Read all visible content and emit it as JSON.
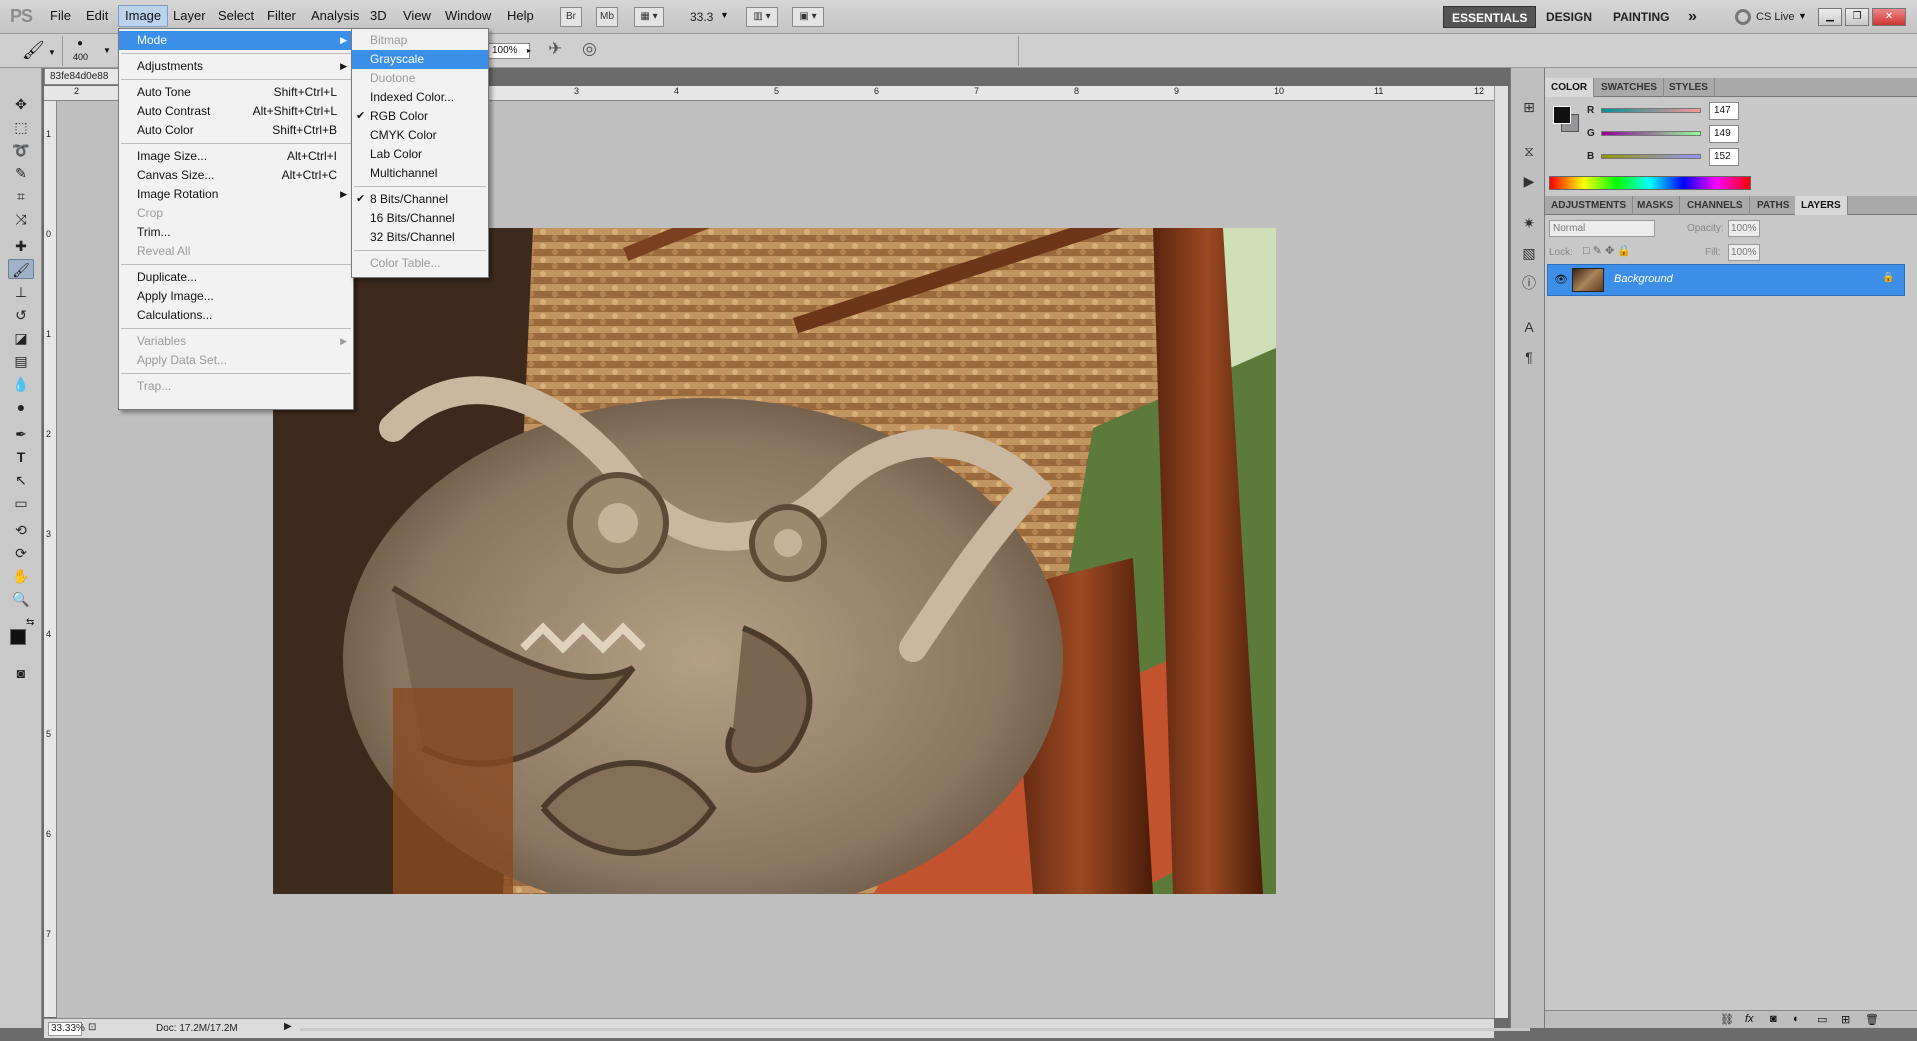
{
  "menubar": {
    "logo": "PS",
    "items": [
      "File",
      "Edit",
      "Image",
      "Layer",
      "Select",
      "Filter",
      "Analysis",
      "3D",
      "View",
      "Window",
      "Help"
    ],
    "bridge": "Br",
    "minibridge": "Mb",
    "zoom": "33.3",
    "workspaces": [
      "ESSENTIALS",
      "DESIGN",
      "PAINTING"
    ],
    "more": "»",
    "cslive": "CS Live"
  },
  "options": {
    "brush_size": "400",
    "flow": "100%"
  },
  "document": {
    "tab_title": "83fe84d0e88",
    "ruler_top": [
      "2",
      "3",
      "4",
      "5",
      "6",
      "7",
      "8",
      "9",
      "10",
      "11",
      "12"
    ],
    "ruler_left": [
      "1",
      "0",
      "1",
      "2",
      "3",
      "4",
      "5",
      "6",
      "7"
    ],
    "zoom_status": "33.33%",
    "doc_info": "Doc: 17.2M/17.2M"
  },
  "image_menu": [
    {
      "label": "Mode",
      "hl": true,
      "sub": true
    },
    {
      "sep": true
    },
    {
      "label": "Adjustments",
      "sub": true
    },
    {
      "sep": true
    },
    {
      "label": "Auto Tone",
      "sc": "Shift+Ctrl+L"
    },
    {
      "label": "Auto Contrast",
      "sc": "Alt+Shift+Ctrl+L"
    },
    {
      "label": "Auto Color",
      "sc": "Shift+Ctrl+B"
    },
    {
      "sep": true
    },
    {
      "label": "Image Size...",
      "sc": "Alt+Ctrl+I"
    },
    {
      "label": "Canvas Size...",
      "sc": "Alt+Ctrl+C"
    },
    {
      "label": "Image Rotation",
      "sub": true
    },
    {
      "label": "Crop",
      "dis": true
    },
    {
      "label": "Trim..."
    },
    {
      "label": "Reveal All",
      "dis": true
    },
    {
      "sep": true
    },
    {
      "label": "Duplicate..."
    },
    {
      "label": "Apply Image..."
    },
    {
      "label": "Calculations..."
    },
    {
      "sep": true
    },
    {
      "label": "Variables",
      "dis": true,
      "sub": true
    },
    {
      "label": "Apply Data Set...",
      "dis": true
    },
    {
      "sep": true
    },
    {
      "label": "Trap...",
      "dis": true
    }
  ],
  "mode_menu": [
    {
      "label": "Bitmap",
      "dis": true
    },
    {
      "label": "Grayscale",
      "hl": true
    },
    {
      "label": "Duotone",
      "dis": true
    },
    {
      "label": "Indexed Color..."
    },
    {
      "label": "RGB Color",
      "chk": true
    },
    {
      "label": "CMYK Color"
    },
    {
      "label": "Lab Color"
    },
    {
      "label": "Multichannel"
    },
    {
      "sep": true
    },
    {
      "label": "8 Bits/Channel",
      "chk": true
    },
    {
      "label": "16 Bits/Channel"
    },
    {
      "label": "32 Bits/Channel"
    },
    {
      "sep": true
    },
    {
      "label": "Color Table...",
      "dis": true
    }
  ],
  "color_panel": {
    "tabs": [
      "COLOR",
      "SWATCHES",
      "STYLES"
    ],
    "r_label": "R",
    "r": "147",
    "g_label": "G",
    "g": "149",
    "b_label": "B",
    "b": "152"
  },
  "layers_panel": {
    "tabs": [
      "ADJUSTMENTS",
      "MASKS",
      "CHANNELS",
      "PATHS",
      "LAYERS"
    ],
    "blend": "Normal",
    "opacity_label": "Opacity:",
    "opacity": "100%",
    "lock_label": "Lock:",
    "fill_label": "Fill:",
    "fill": "100%",
    "layer_name": "Background"
  },
  "colors": {
    "accent": "#3b8fe8",
    "menubar": "#cfcfcf",
    "canvas": "#bfbfbf"
  }
}
